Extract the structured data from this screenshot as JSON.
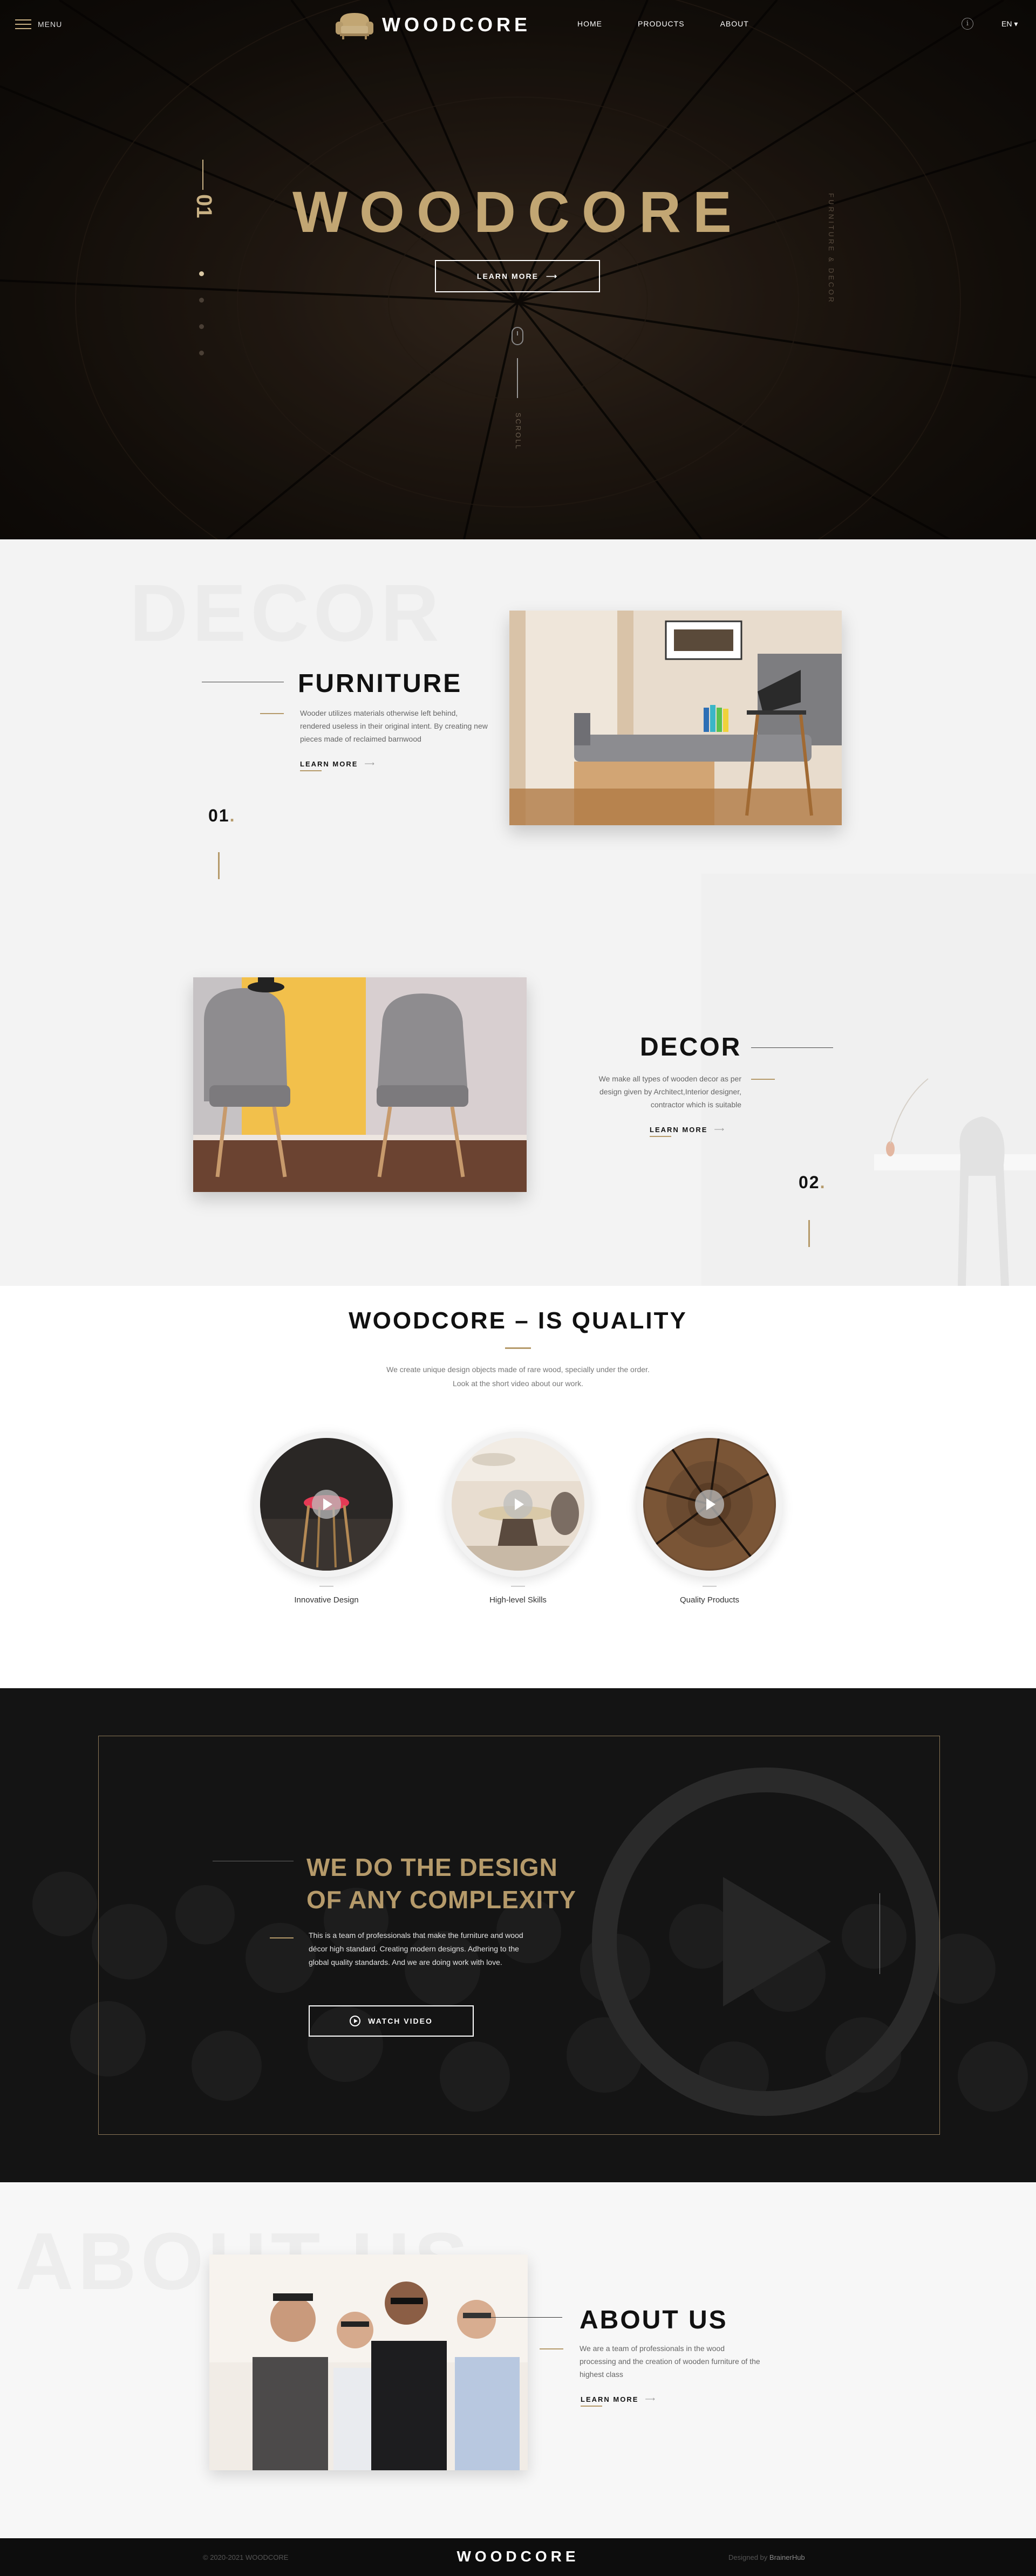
{
  "header": {
    "menu_label": "MENU",
    "logo_text": "WOODCORE",
    "nav": [
      "HOME",
      "PRODUCTS",
      "ABOUT"
    ],
    "lang": "EN",
    "info_icon": "info-icon"
  },
  "hero": {
    "slide_number": "01",
    "title": "WOODCORE",
    "button": "LEARN MORE",
    "scroll_label": "SCROLL",
    "side_text": "FURNITURE & DECOR",
    "slides_total": 4,
    "active_slide": 1
  },
  "features": [
    {
      "ghost": "DECOR",
      "title": "FURNITURE",
      "text": "Wooder utilizes materials otherwise left behind, rendered useless in their original intent. By creating new pieces made of reclaimed barnwood",
      "link": "LEARN MORE",
      "number": "01"
    },
    {
      "title": "DECOR",
      "text": "We make all types of wooden decor as per design given by Architect,Interior designer, contractor which is suitable",
      "link": "LEARN MORE",
      "number": "02"
    }
  ],
  "quality": {
    "title": "WOODCORE – IS QUALITY",
    "text_line1": "We create unique design objects made of rare wood, specially under the order.",
    "text_line2": "Look at the short video about our work.",
    "videos": [
      {
        "label": "Innovative Design",
        "icon": "play-icon"
      },
      {
        "label": "High-level Skills",
        "icon": "play-icon"
      },
      {
        "label": "Quality Products",
        "icon": "play-icon"
      }
    ]
  },
  "design": {
    "title_line1": "WE DO THE DESIGN",
    "title_line2": "OF ANY COMPLEXITY",
    "text": "This is a team of professionals that make the furniture and wood décor high standard. Creating modern designs. Adhering to the global quality standards. And we are doing work with love.",
    "button": "WATCH VIDEO"
  },
  "about": {
    "ghost": "ABOUT US",
    "title": "ABOUT US",
    "text": "We are a team of professionals in the wood processing and the creation of wooden furniture of the highest class",
    "link": "LEARN MORE"
  },
  "footer": {
    "copyright": "© 2020-2021 WOODCORE",
    "logo": "WOODCORE",
    "designed_prefix": "Designed by",
    "designed_by": "BrainerHub"
  },
  "colors": {
    "accent": "#b59a6a",
    "dark_bg": "#161616",
    "light_bg": "#f3f3f3"
  }
}
